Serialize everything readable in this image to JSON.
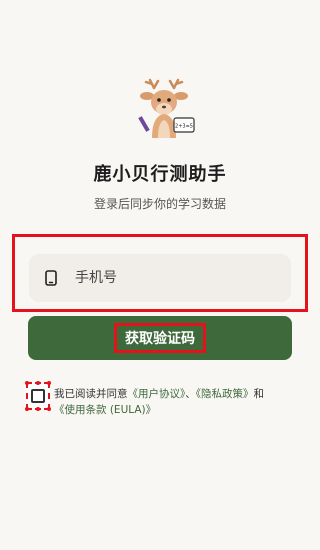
{
  "app": {
    "title": "鹿小贝行测助手",
    "subtitle": "登录后同步你的学习数据"
  },
  "login": {
    "phone_placeholder": "手机号",
    "get_code_label": "获取验证码"
  },
  "agreement": {
    "prefix": "我已阅读并同意",
    "user_agreement": "《用户协议》",
    "separator": "、",
    "privacy_policy": "《隐私政策》",
    "and": "和",
    "terms_of_use": "《使用条款 (EULA)》"
  },
  "mascot": {
    "board_text": "2+3=5"
  },
  "colors": {
    "primary": "#3e693b",
    "highlight": "#e3121b",
    "background": "#f9f7f4"
  }
}
